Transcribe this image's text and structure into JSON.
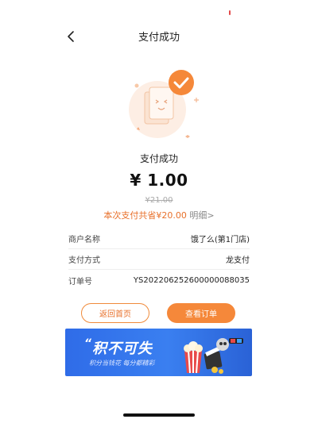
{
  "header": {
    "title": "支付成功"
  },
  "result": {
    "label": "支付成功",
    "amount": "¥ 1.00",
    "original_price": "¥21.00",
    "saving_text": "本次支付共省¥20.00",
    "detail_link": "明细>"
  },
  "info": [
    {
      "key": "商户名称",
      "value": "饿了么(第1门店)"
    },
    {
      "key": "支付方式",
      "value": "龙支付"
    },
    {
      "key": "订单号",
      "value": "YS20220625260000008803​5"
    }
  ],
  "buttons": {
    "home": "返回首页",
    "order": "查看订单"
  },
  "banner": {
    "title_quote": "“",
    "title": "积不可失",
    "subtitle": "积分当钱花  每分都精彩",
    "icons": [
      "popcorn-icon",
      "film-clapper-icon",
      "3d-glasses-icon"
    ]
  },
  "colors": {
    "accent": "#f5883a",
    "accent_text": "#e8702a",
    "banner_blue": "#2f6ce8"
  }
}
